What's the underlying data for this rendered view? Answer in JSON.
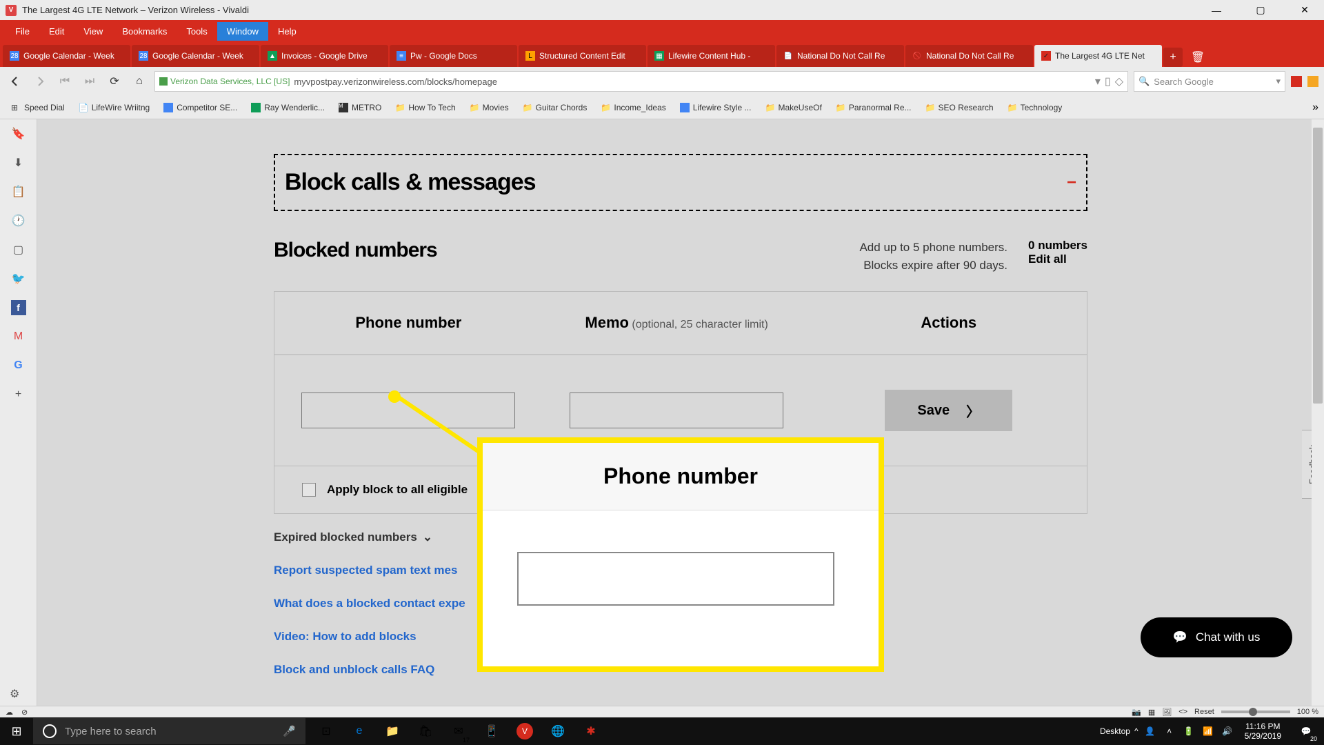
{
  "window": {
    "title": "The Largest 4G LTE Network – Verizon Wireless - Vivaldi"
  },
  "menubar": [
    "File",
    "Edit",
    "View",
    "Bookmarks",
    "Tools",
    "Window",
    "Help"
  ],
  "menubar_active": "Window",
  "tabs": [
    {
      "label": "Google Calendar - Week"
    },
    {
      "label": "Google Calendar - Week"
    },
    {
      "label": "Invoices - Google Drive"
    },
    {
      "label": "Pw - Google Docs"
    },
    {
      "label": "Structured Content Edit"
    },
    {
      "label": "Lifewire Content Hub - "
    },
    {
      "label": "National Do Not Call Re"
    },
    {
      "label": "National Do Not Call Re"
    },
    {
      "label": "The Largest 4G LTE Net",
      "active": true
    }
  ],
  "addressbar": {
    "security_text": "Verizon Data Services, LLC [US]",
    "url": "myvpostpay.verizonwireless.com/blocks/homepage",
    "search_placeholder": "Search Google"
  },
  "bookmarks": [
    "Speed Dial",
    "LifeWire Wriitng",
    "Competitor SE...",
    "Ray Wenderlic...",
    "METRO",
    "How To Tech",
    "Movies",
    "Guitar Chords",
    "Income_Ideas",
    "Lifewire Style ...",
    "MakeUseOf",
    "Paranormal Re...",
    "SEO Research",
    "Technology"
  ],
  "page": {
    "header_title": "Block calls & messages",
    "blocked_title": "Blocked numbers",
    "info_line1": "Add up to 5 phone numbers.",
    "info_line2": "Blocks expire after 90 days.",
    "count_label": "0 numbers",
    "edit_label": "Edit all",
    "col_phone": "Phone number",
    "col_memo": "Memo",
    "col_memo_opt": " (optional, 25 character limit)",
    "col_actions": "Actions",
    "save_label": "Save",
    "apply_label": "Apply block to all eligible",
    "expired_label": "Expired blocked numbers",
    "link1": "Report suspected spam text mes",
    "link2": "What does a blocked contact expe",
    "link3": "Video: How to add blocks",
    "link4": "Block and unblock calls FAQ"
  },
  "callout": {
    "title": "Phone number"
  },
  "feedback_label": "Feedback",
  "chat_label": "Chat with us",
  "statusbar": {
    "reset": "Reset",
    "zoom": "100 %"
  },
  "taskbar": {
    "search_placeholder": "Type here to search",
    "desktop_label": "Desktop",
    "time": "11:16 PM",
    "date": "5/29/2019",
    "notif_count": "20",
    "mail_count": "17"
  }
}
